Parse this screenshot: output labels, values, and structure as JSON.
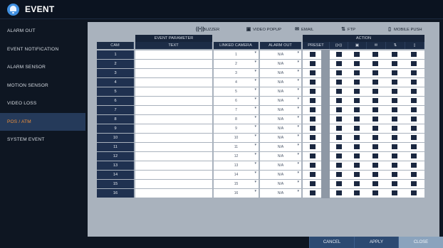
{
  "window": {
    "title": "EVENT"
  },
  "sidebar": {
    "items": [
      {
        "label": "ALARM OUT",
        "active": false
      },
      {
        "label": "EVENT NOTIFICATION",
        "active": false
      },
      {
        "label": "ALARM SENSOR",
        "active": false
      },
      {
        "label": "MOTION SENSOR",
        "active": false
      },
      {
        "label": "VIDEO LOSS",
        "active": false
      },
      {
        "label": "POS / ATM",
        "active": true
      },
      {
        "label": "SYSTEM EVENT",
        "active": false
      }
    ]
  },
  "legend": {
    "buzzer": {
      "icon": "buzzer-icon",
      "label": "BUZZER"
    },
    "video_popup": {
      "icon": "video-popup-icon",
      "label": "VIDEO POPUP"
    },
    "email": {
      "icon": "email-icon",
      "label": "EMAIL"
    },
    "ftp": {
      "icon": "ftp-icon",
      "label": "FTP"
    },
    "mobile_push": {
      "icon": "mobile-push-icon",
      "label": "MOBILE PUSH"
    }
  },
  "table": {
    "group_headers": {
      "event_parameter": "EVENT PARAMETER",
      "action": "ACTION"
    },
    "columns": {
      "cam": "CAM",
      "text": "TEXT",
      "linked_camera": "LINKED CAMERA",
      "alarm_out": "ALARM OUT",
      "preset": "PRESET"
    },
    "rows": [
      {
        "cam": "1",
        "linked": "1",
        "alarm": "N/A"
      },
      {
        "cam": "2",
        "linked": "2",
        "alarm": "N/A"
      },
      {
        "cam": "3",
        "linked": "3",
        "alarm": "N/A"
      },
      {
        "cam": "4",
        "linked": "4",
        "alarm": "N/A"
      },
      {
        "cam": "5",
        "linked": "5",
        "alarm": "N/A"
      },
      {
        "cam": "6",
        "linked": "6",
        "alarm": "N/A"
      },
      {
        "cam": "7",
        "linked": "7",
        "alarm": "N/A"
      },
      {
        "cam": "8",
        "linked": "8",
        "alarm": "N/A"
      },
      {
        "cam": "9",
        "linked": "9",
        "alarm": "N/A"
      },
      {
        "cam": "10",
        "linked": "10",
        "alarm": "N/A"
      },
      {
        "cam": "11",
        "linked": "11",
        "alarm": "N/A"
      },
      {
        "cam": "12",
        "linked": "12",
        "alarm": "N/A"
      },
      {
        "cam": "13",
        "linked": "13",
        "alarm": "N/A"
      },
      {
        "cam": "14",
        "linked": "14",
        "alarm": "N/A"
      },
      {
        "cam": "15",
        "linked": "15",
        "alarm": "N/A"
      },
      {
        "cam": "16",
        "linked": "16",
        "alarm": "N/A"
      }
    ]
  },
  "buttons": {
    "cancel": "CANCEL",
    "apply": "APPLY",
    "close": "CLOSE"
  },
  "colors": {
    "accent": "#f2913a",
    "panel": "#a9b2bd",
    "header": "#17243a"
  }
}
